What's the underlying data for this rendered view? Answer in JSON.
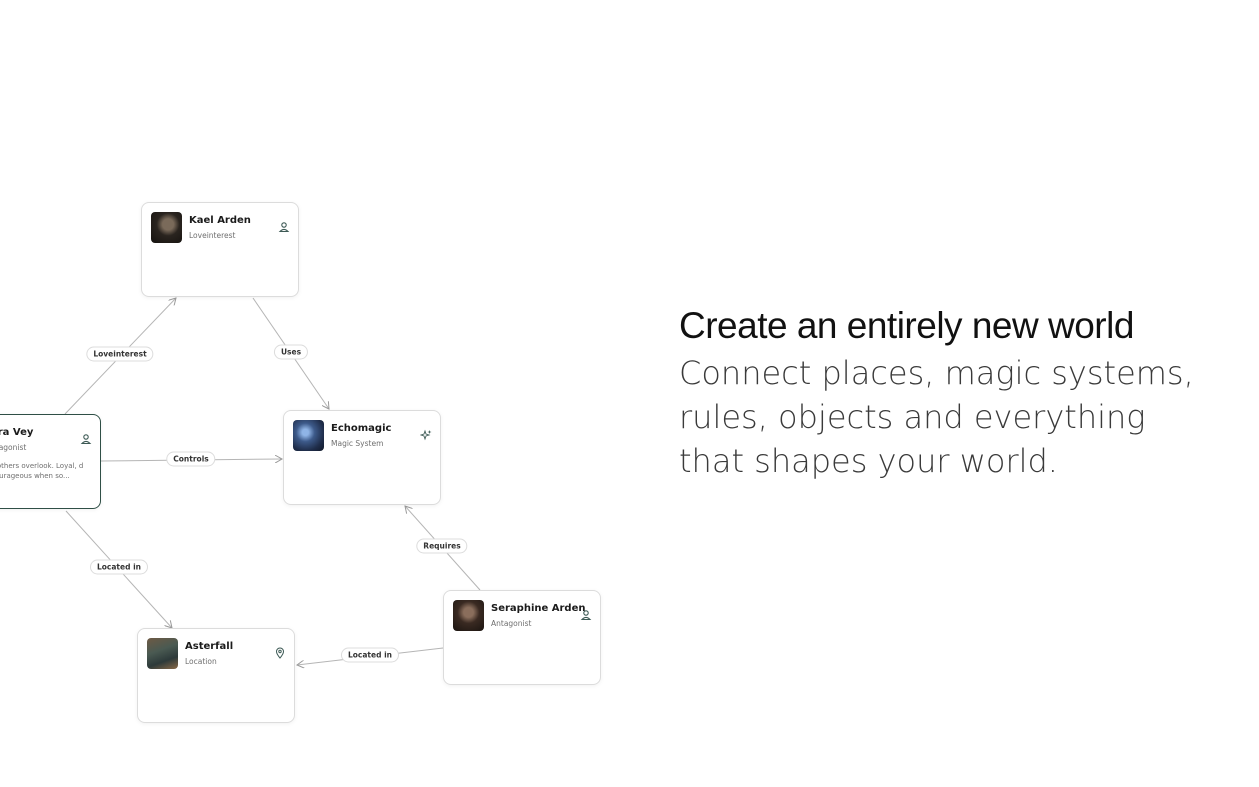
{
  "hero": {
    "title": "Create an entirely new world",
    "subtitle": "Connect places, magic systems, rules, objects and everything that shapes your world."
  },
  "nodes": {
    "kael": {
      "name": "Kael Arden",
      "role": "Loveinterest",
      "icon": "person-icon"
    },
    "lara": {
      "name": "ara Vey",
      "role": "ntagonist",
      "description": "s others overlook. Loyal, d courageous when so...",
      "icon": "person-icon"
    },
    "echo": {
      "name": "Echomagic",
      "role": "Magic System",
      "icon": "sparkle-icon"
    },
    "aster": {
      "name": "Asterfall",
      "role": "Location",
      "icon": "map-pin-icon"
    },
    "sera": {
      "name": "Seraphine Arden",
      "role": "Antagonist",
      "icon": "person-icon"
    }
  },
  "edges": {
    "loveinterest": "Loveinterest",
    "uses": "Uses",
    "controls": "Controls",
    "requires": "Requires",
    "located_in_1": "Located in",
    "located_in_2": "Located in"
  },
  "colors": {
    "selected_border": "#2f4f46",
    "edge": "#b5b5b5",
    "icon": "#3d5a55"
  }
}
